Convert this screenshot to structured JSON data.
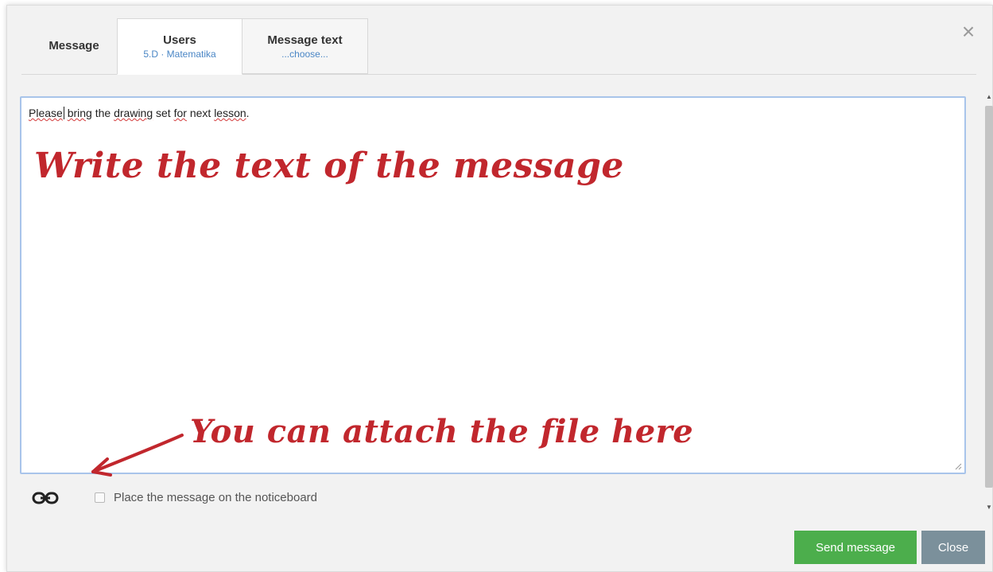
{
  "tabs": {
    "message": {
      "title": "Message"
    },
    "users": {
      "title": "Users",
      "subtitle": "5.D · Matematika"
    },
    "message_text": {
      "title": "Message text",
      "subtitle": "...choose..."
    }
  },
  "close_icon": "×",
  "editor": {
    "words": [
      "Please",
      " ",
      "bring",
      " the ",
      "drawing",
      " set ",
      "for",
      " next ",
      "lesson",
      "."
    ]
  },
  "annotations": {
    "write": "Write the text of the message",
    "attach": "You can attach the file here"
  },
  "footer": {
    "noticeboard_label": "Place the message on the noticeboard",
    "noticeboard_checked": false
  },
  "buttons": {
    "send": "Send message",
    "close": "Close"
  },
  "colors": {
    "accent_blue": "#4a86c5",
    "annotation_red": "#c1272d",
    "send_green": "#4cae4c",
    "close_gray": "#7b909b"
  },
  "icons": [
    "close-icon",
    "link-icon",
    "resize-grip-icon",
    "scroll-up-icon",
    "scroll-down-icon",
    "arrow-annotation-icon"
  ]
}
